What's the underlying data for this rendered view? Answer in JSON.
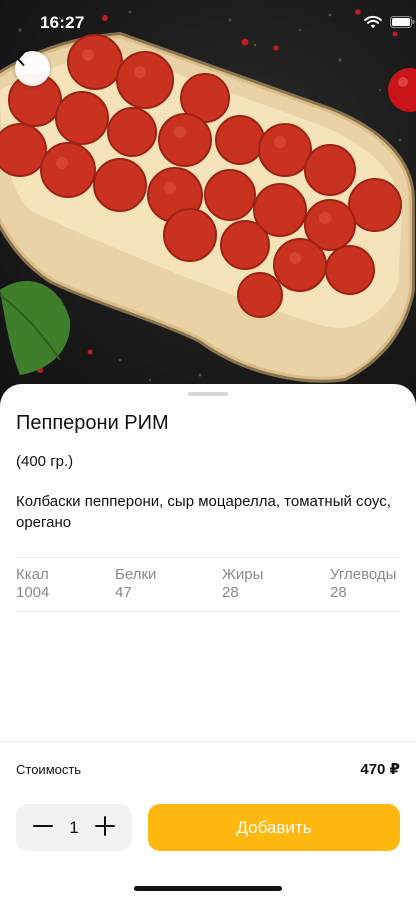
{
  "status_bar": {
    "time": "16:27"
  },
  "hero": {
    "image_alt": "pepperoni pizza photo"
  },
  "product": {
    "title": "Пепперони РИМ",
    "weight": "(400 гр.)",
    "description": "Колбаски пепперони, сыр моцарелла, томатный соус, орегано"
  },
  "nutrition": [
    {
      "label": "Ккал",
      "value": "1004"
    },
    {
      "label": "Белки",
      "value": "47"
    },
    {
      "label": "Жиры",
      "value": "28"
    },
    {
      "label": "Углеводы",
      "value": "28"
    }
  ],
  "price": {
    "label": "Стоимость",
    "value": "470 ₽"
  },
  "stepper": {
    "quantity": "1"
  },
  "actions": {
    "add_label": "Добавить"
  },
  "colors": {
    "accent": "#ffb80f",
    "background": "#ffffff",
    "stepper_bg": "#f2f2f2",
    "muted_text": "#8a8a8a"
  },
  "icons": [
    "back-chevron-icon",
    "wifi-icon",
    "battery-icon",
    "minus-icon",
    "plus-icon"
  ]
}
